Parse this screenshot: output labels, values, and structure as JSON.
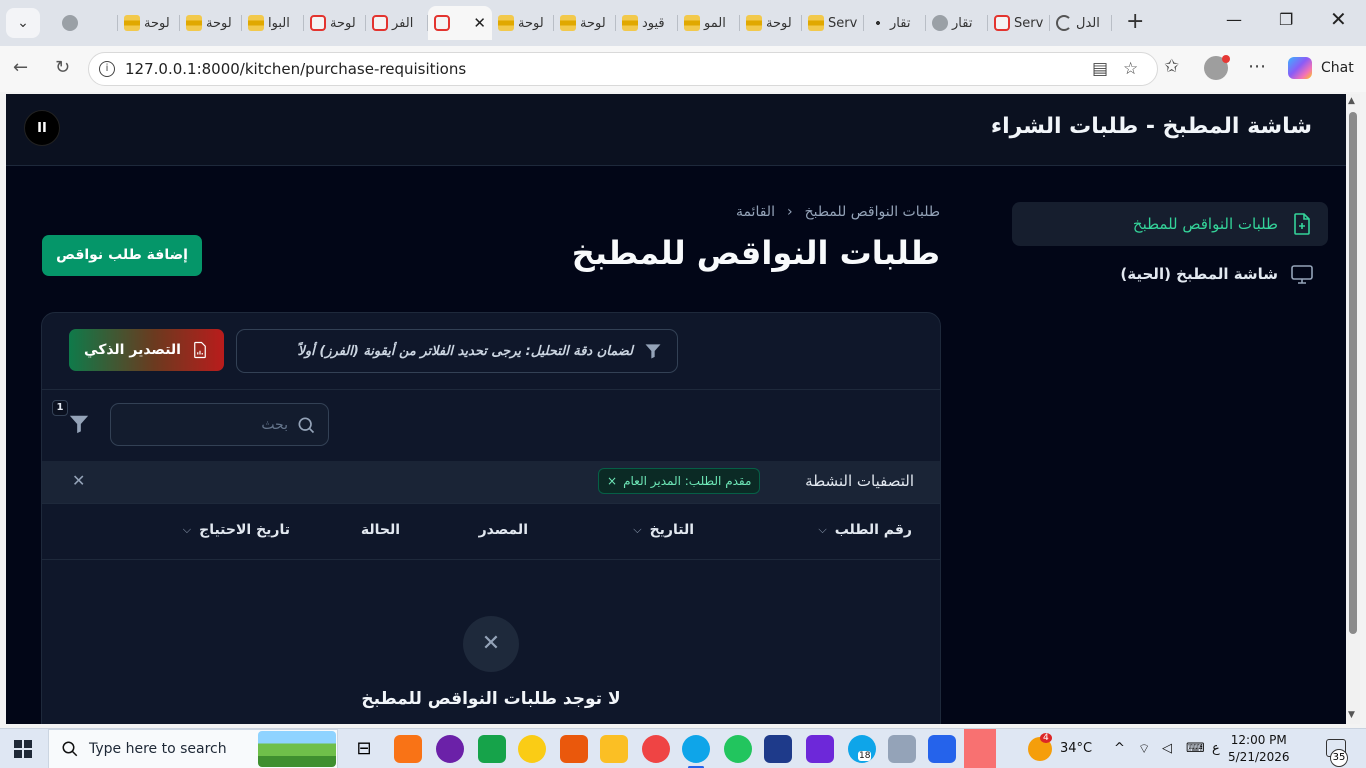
{
  "browser": {
    "tabs": [
      {
        "label": "",
        "favicon": "gray-favicon"
      },
      {
        "label": "لوحة",
        "favicon": "stack-favicon"
      },
      {
        "label": "لوحة",
        "favicon": "stack-favicon"
      },
      {
        "label": "البوا",
        "favicon": "stack-favicon"
      },
      {
        "label": "لوحة",
        "favicon": "laravel-favicon"
      },
      {
        "label": "الفر",
        "favicon": "laravel-favicon"
      },
      {
        "label": "",
        "favicon": "laravel-favicon",
        "active": true
      },
      {
        "label": "لوحة",
        "favicon": "stack-favicon"
      },
      {
        "label": "لوحة",
        "favicon": "stack-favicon"
      },
      {
        "label": "قيود",
        "favicon": "stack-favicon"
      },
      {
        "label": "المو",
        "favicon": "stack-favicon"
      },
      {
        "label": "لوحة",
        "favicon": "stack-favicon"
      },
      {
        "label": "Serv",
        "favicon": "stack-favicon"
      },
      {
        "label": "تقار",
        "favicon": "dots-favicon"
      },
      {
        "label": "تقار",
        "favicon": "gray-favicon"
      },
      {
        "label": "Serv",
        "favicon": "laravel-favicon"
      },
      {
        "label": "الدل",
        "favicon": "spin-favicon"
      }
    ],
    "url": "127.0.0.1:8000/kitchen/purchase-requisitions",
    "chat_label": "Chat"
  },
  "app": {
    "header_title": "شاشة المطبخ - طلبات الشراء",
    "pause_label": "II",
    "sidebar": [
      {
        "label": "طلبات النواقص للمطبخ",
        "icon": "file-plus-icon",
        "active": true
      },
      {
        "label": "شاشة المطبخ (الحية)",
        "icon": "monitor-icon",
        "active": false
      }
    ],
    "breadcrumb": {
      "parent": "طلبات النواقص للمطبخ",
      "separator": "›",
      "current": "القائمة"
    },
    "page_title": "طلبات النواقص للمطبخ",
    "add_button": "إضافة طلب نواقص",
    "notice": "لضمان دقة التحليل: يرجى تحديد الفلاتر من أيقونة (الفرز) أولاً",
    "export_button": "التصدير الذكي",
    "search_placeholder": "بحث",
    "filter_count": "1",
    "active_filters_label": "التصفيات النشطة",
    "active_filter_chip": "مقدم الطلب: المدير العام",
    "columns": [
      {
        "label": "رقم الطلب",
        "sortable": true
      },
      {
        "label": "التاريخ",
        "sortable": true
      },
      {
        "label": "المصدر",
        "sortable": false
      },
      {
        "label": "الحالة",
        "sortable": false
      },
      {
        "label": "تاريخ الاحتياج",
        "sortable": true
      }
    ],
    "empty_message": "لا توجد طلبات النواقص للمطبخ",
    "colors": {
      "accent": "#10b981",
      "button": "#059669",
      "background": "#020617"
    }
  },
  "taskbar": {
    "search_placeholder": "Type here to search",
    "weather": "34°C",
    "weather_badge": "4",
    "lang": "ع",
    "time": "12:00 PM",
    "date": "5/21/2026",
    "notification_count": "35",
    "teams_badge": "18"
  }
}
